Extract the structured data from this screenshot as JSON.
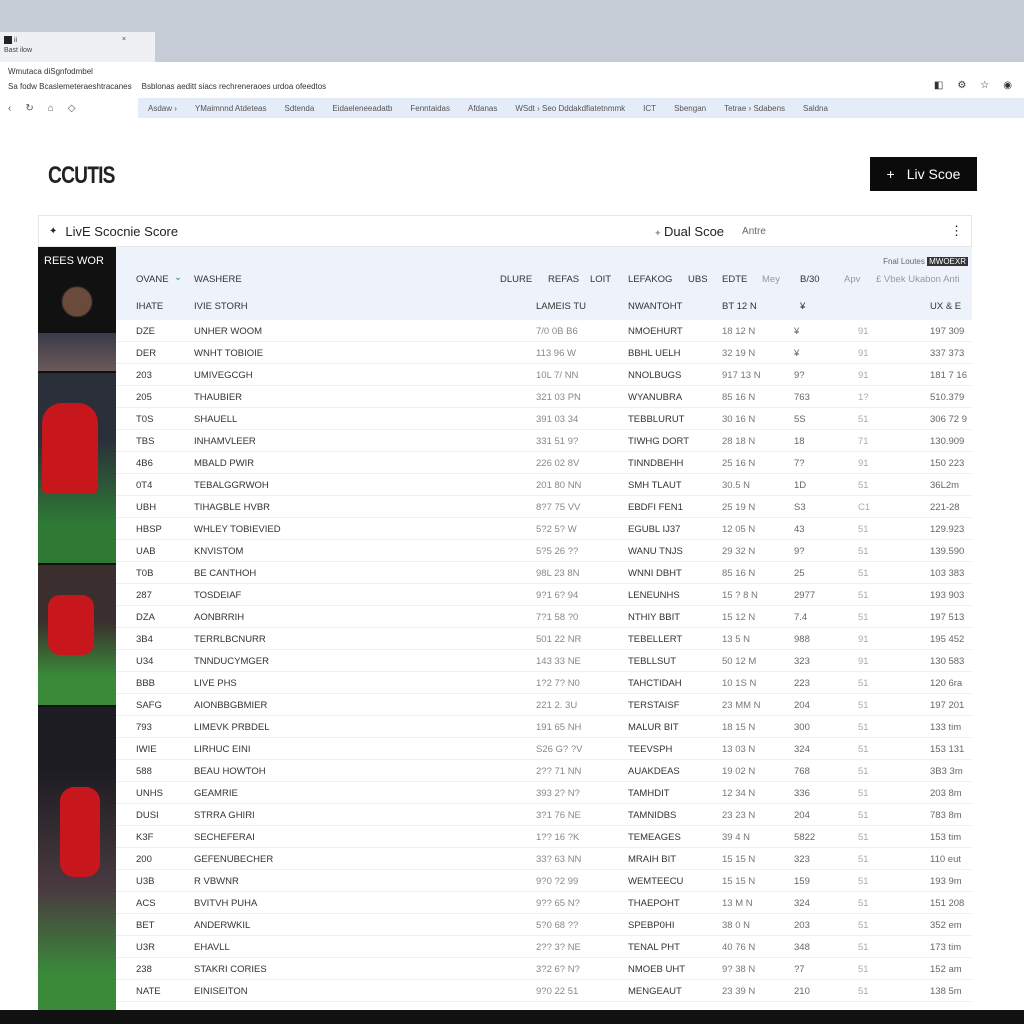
{
  "browser": {
    "tab_title": "ii",
    "tab_sub": "Bast ilow",
    "tab_close": "×",
    "url_line": "Wmutaca diSgnfodmbel",
    "bookmark_prefix": "Sa fodw Bcaslemeteraeshtracanes",
    "bookmark_path": "Bsblonas aeditt siacs rechreneraoes urdoa ofeedtos",
    "bookmarks": [
      "Asdaw ›",
      "YMaimnnd Atdeteas",
      "Sdtenda",
      "Eidaeleneeadatb",
      "Fenntaidas",
      "Afdanas",
      "WSdt › Seo Dddakdfiatetnmmk",
      "ICT",
      "Sbengan",
      "Tetrae › Sdabens",
      "Saldna"
    ]
  },
  "header": {
    "logo": "CCUTIS",
    "live_button": "Liv Scoe"
  },
  "card": {
    "title": "LivE Scocnie Score",
    "dual": "Dual Scoe",
    "sub": "Antre"
  },
  "side": {
    "label": "REES WOR"
  },
  "table": {
    "top_right": "Fnal Loutes",
    "top_tag": "MWOEXR",
    "headers": [
      "OVANE",
      "WASHERE",
      "DLURE",
      "REFAS",
      "LOIT",
      "LEFAKOG",
      "UBS",
      "EDTE",
      "Mey",
      "B/30",
      "Apv",
      "£ Vbek Ukabon Anti"
    ],
    "subheaders": [
      "IHATE",
      "IVIE STORH",
      "LAMEIS TU",
      "NWANTOHT",
      "BT 12 N",
      "¥",
      "UX & E"
    ],
    "rows": [
      [
        "DZE",
        "UNHER WOOM",
        "7/0 0B B6",
        "NMOEHURT",
        "18 12 N",
        "¥",
        "91",
        "197 309"
      ],
      [
        "DER",
        "WNHT TOBIOIE",
        "113 96 W",
        "BBHL UELH",
        "32 19 N",
        "¥",
        "91",
        "337 373"
      ],
      [
        "203",
        "UMIVEGCGH",
        "10L 7/ NN",
        "NNOLBUGS",
        "917 13 N",
        "9?",
        "91",
        "181 7 16"
      ],
      [
        "205",
        "THAUBIER",
        "321 03 PN",
        "WYANUBRA",
        "85 16 N",
        "763",
        "1?",
        "510.379"
      ],
      [
        "T0S",
        "SHAUELL",
        "391 03 34",
        "TEBBLURUT",
        "30 16 N",
        "5S",
        "51",
        "306 72 9"
      ],
      [
        "TBS",
        "INHAMVLEER",
        "331 51 9?",
        "TIWHG DORT",
        "28 18 N",
        "18",
        "71",
        "130.909"
      ],
      [
        "4B6",
        "MBALD PWIR",
        "226 02 8V",
        "TINNDBEHH",
        "25 16 N",
        "7?",
        "91",
        "150 223"
      ],
      [
        "0T4",
        "TEBALGGRWOH",
        "201 80 NN",
        "SMH TLAUT",
        "30.5 N",
        "1D",
        "51",
        "36L2m"
      ],
      [
        "UBH",
        "TIHAGBLE HVBR",
        "8?7 75 VV",
        "EBDFI FEN1",
        "25 19 N",
        "S3",
        "C1",
        "221-28"
      ],
      [
        "HBSP",
        "WHLEY TOBIEVIED",
        "5?2 5? W",
        "EGUBL IJ37",
        "12 05 N",
        "43",
        "51",
        "129.923"
      ],
      [
        "UAB",
        "KNVISTOM",
        "5?5 26 ??",
        "WANU TNJS",
        "29 32 N",
        "9?",
        "51",
        "139.590"
      ],
      [
        "T0B",
        "BE CANTHOH",
        "98L 23 8N",
        "WNNI DBHT",
        "85 16 N",
        "25",
        "51",
        "103 383"
      ],
      [
        "287",
        "TOSDEIAF",
        "9?1 6? 94",
        "LENEUNHS",
        "15 ? 8 N",
        "2977",
        "51",
        "193 903"
      ],
      [
        "DZA",
        "AONBRRIH",
        "7?1 58 ?0",
        "NTHIY BBIT",
        "15 12 N",
        "7.4",
        "51",
        "197 513"
      ],
      [
        "3B4",
        "TERRLBCNURR",
        "501 22 NR",
        "TEBELLERT",
        "13 5 N",
        "988",
        "91",
        "195 452"
      ],
      [
        "U34",
        "TNNDUCYMGER",
        "143 33 NE",
        "TEBLLSUT",
        "50 12 M",
        "323",
        "91",
        "130 583"
      ],
      [
        "BBB",
        "LIVE PHS",
        "1?2 7? N0",
        "TAHCTIDAH",
        "10 1S N",
        "223",
        "51",
        "120 6ra"
      ],
      [
        "SAFG",
        "AIONBBGBMIER",
        "221 2. 3U",
        "TERSTAISF",
        "23 MM N",
        "204",
        "51",
        "197 201"
      ],
      [
        "793",
        "LIMEVK PRBDEL",
        "191 65 NH",
        "MALUR BIT",
        "18 15 N",
        "300",
        "51",
        "133 tim"
      ],
      [
        "IWIE",
        "LIRHUC EINI",
        "S26 G? ?V",
        "TEEVSPH",
        "13 03 N",
        "324",
        "51",
        "153 131"
      ],
      [
        "588",
        "BEAU HOWTOH",
        "2?? 71 NN",
        "AUAKDEAS",
        "19 02 N",
        "768",
        "51",
        "3B3 3m"
      ],
      [
        "UNHS",
        "GEAMRIE",
        "393 2? N?",
        "TAMHDIT",
        "12 34 N",
        "336",
        "51",
        "203 8m"
      ],
      [
        "DUSI",
        "STRRA GHIRI",
        "3?1 76 NE",
        "TAMNIDBS",
        "23 23 N",
        "204",
        "51",
        "783 8m"
      ],
      [
        "K3F",
        "SECHEFERAI",
        "1?? 16 ?K",
        "TEMEAGES",
        "39 4 N",
        "5822",
        "51",
        "153 tim"
      ],
      [
        "200",
        "GEFENUBECHER",
        "33? 63 NN",
        "MRAIH BIT",
        "15 15 N",
        "323",
        "51",
        "110 eut"
      ],
      [
        "U3B",
        "R VBWNR",
        "9?0 ?2 99",
        "WEMTEECU",
        "15 15 N",
        "159",
        "51",
        "193 9m"
      ],
      [
        "ACS",
        "BVITVH PUHA",
        "9?? 65 N?",
        "THAEPOHT",
        "13 M N",
        "324",
        "51",
        "151 208"
      ],
      [
        "BET",
        "ANDERWKIL",
        "5?0 68 ??",
        "SPEBP0HI",
        "38 0 N",
        "203",
        "51",
        "352 em"
      ],
      [
        "U3R",
        "EHAVLL",
        "2?? 3? NE",
        "TENAL PHT",
        "40 76 N",
        "348",
        "51",
        "173 tim"
      ],
      [
        "238",
        "STAKRI CORIES",
        "3?2 6? N?",
        "NMOEB UHT",
        "9? 38 N",
        "?7",
        "51",
        "152 am"
      ],
      [
        "NATE",
        "EINISEITON",
        "9?0 22 51",
        "MENGEAUT",
        "23 39 N",
        "210",
        "51",
        "138 5m"
      ]
    ]
  },
  "colors": {
    "accent": "#0b0b0b",
    "header_bg": "#eef3fb",
    "sidebar_bg": "#111111",
    "jersey_red": "#c8161d"
  }
}
